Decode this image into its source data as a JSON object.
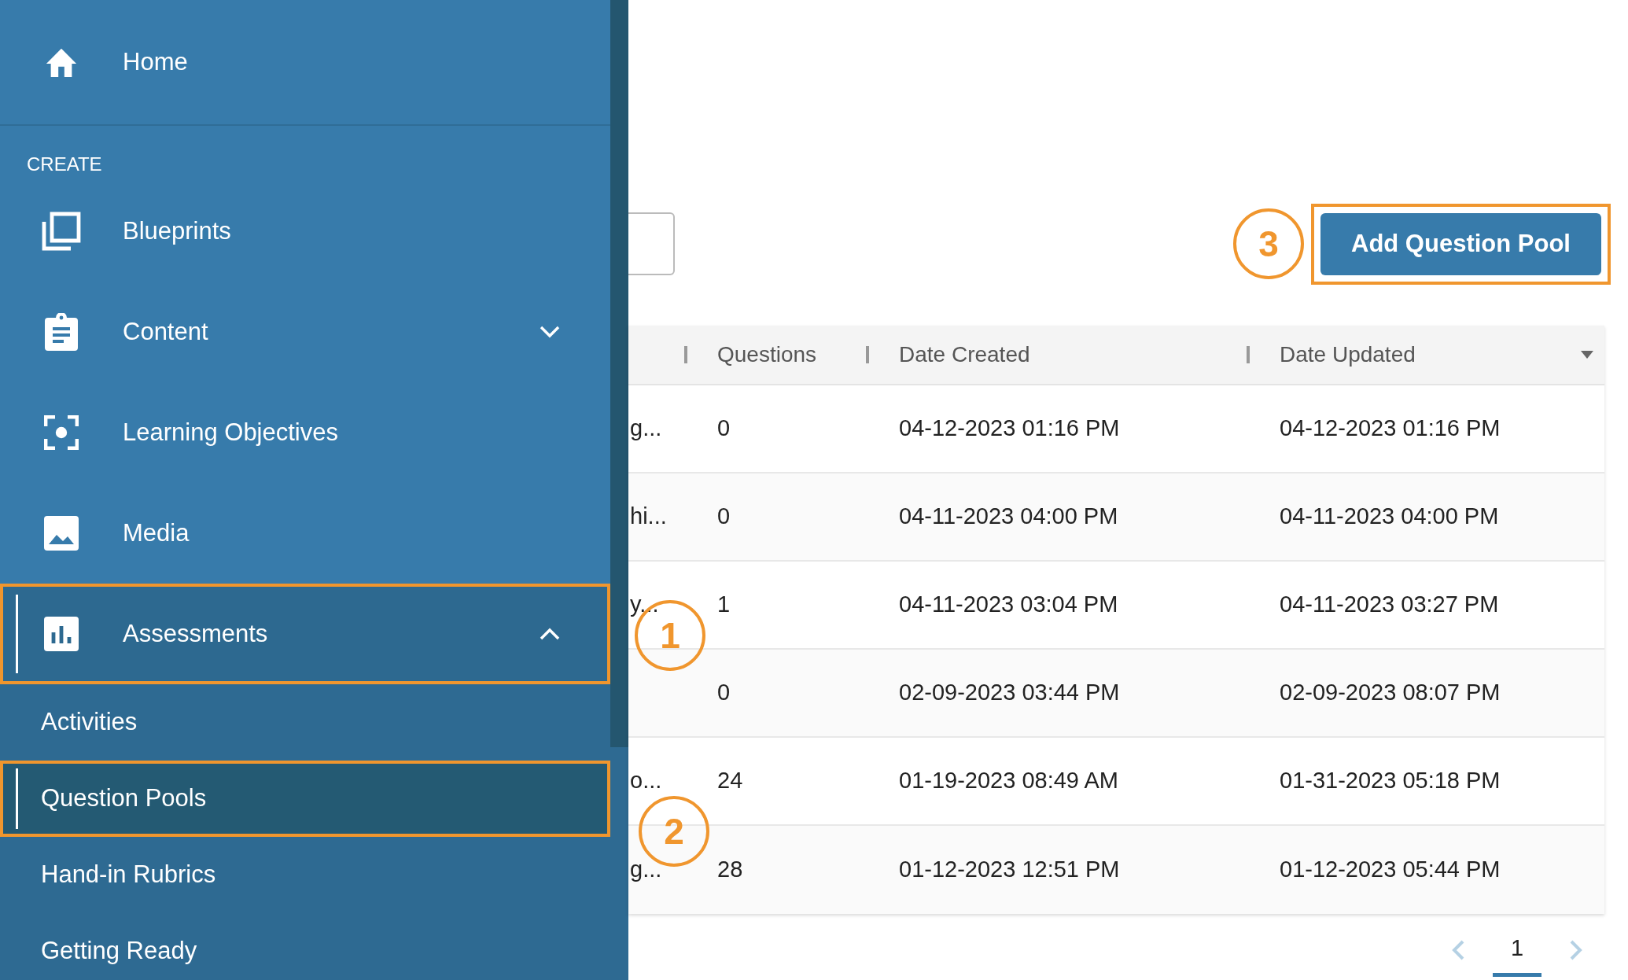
{
  "sidebar": {
    "home": {
      "label": "Home"
    },
    "section_label": "CREATE",
    "items": [
      {
        "label": "Blueprints",
        "active": false,
        "highlighted": false
      },
      {
        "label": "Content",
        "expanded": false,
        "active": false,
        "highlighted": false
      },
      {
        "label": "Learning Objectives",
        "active": false,
        "highlighted": false
      },
      {
        "label": "Media",
        "active": false,
        "highlighted": false
      },
      {
        "label": "Assessments",
        "expanded": true,
        "active": true,
        "highlighted": true,
        "children": [
          {
            "label": "Activities",
            "selected": false,
            "highlighted": false
          },
          {
            "label": "Question Pools",
            "selected": true,
            "highlighted": true
          },
          {
            "label": "Hand-in Rubrics",
            "selected": false,
            "highlighted": false
          },
          {
            "label": "Getting Ready",
            "selected": false,
            "highlighted": false
          }
        ]
      }
    ]
  },
  "toolbar": {
    "add_button": {
      "label": "Add Question Pool",
      "highlighted": true
    }
  },
  "annotations": [
    {
      "number": "1"
    },
    {
      "number": "2"
    },
    {
      "number": "3"
    }
  ],
  "table": {
    "columns": [
      {
        "label": "Questions",
        "sorted": false
      },
      {
        "label": "Date Created",
        "sorted": false
      },
      {
        "label": "Date Updated",
        "sorted": true
      }
    ],
    "rows": [
      {
        "column_1": "g...",
        "questions": "0",
        "date_created": "04-12-2023 01:16 PM",
        "date_updated": "04-12-2023 01:16 PM"
      },
      {
        "column_1": "hi...",
        "questions": "0",
        "date_created": "04-11-2023 04:00 PM",
        "date_updated": "04-11-2023 04:00 PM"
      },
      {
        "column_1": "y...",
        "questions": "1",
        "date_created": "04-11-2023 03:04 PM",
        "date_updated": "04-11-2023 03:27 PM"
      },
      {
        "questions": "0",
        "date_created": "02-09-2023 03:44 PM",
        "date_updated": "02-09-2023 08:07 PM"
      },
      {
        "column_1": "o...",
        "questions": "24",
        "date_created": "01-19-2023 08:49 AM",
        "date_updated": "01-31-2023 05:18 PM"
      },
      {
        "column_1": "g...",
        "questions": "28",
        "date_created": "01-12-2023 12:51 PM",
        "date_updated": "01-12-2023 05:44 PM"
      }
    ]
  },
  "pagination": {
    "previous": {
      "disabled": true
    },
    "pages": [
      {
        "label": "1",
        "selected": true
      }
    ],
    "next": {
      "disabled": true
    }
  }
}
